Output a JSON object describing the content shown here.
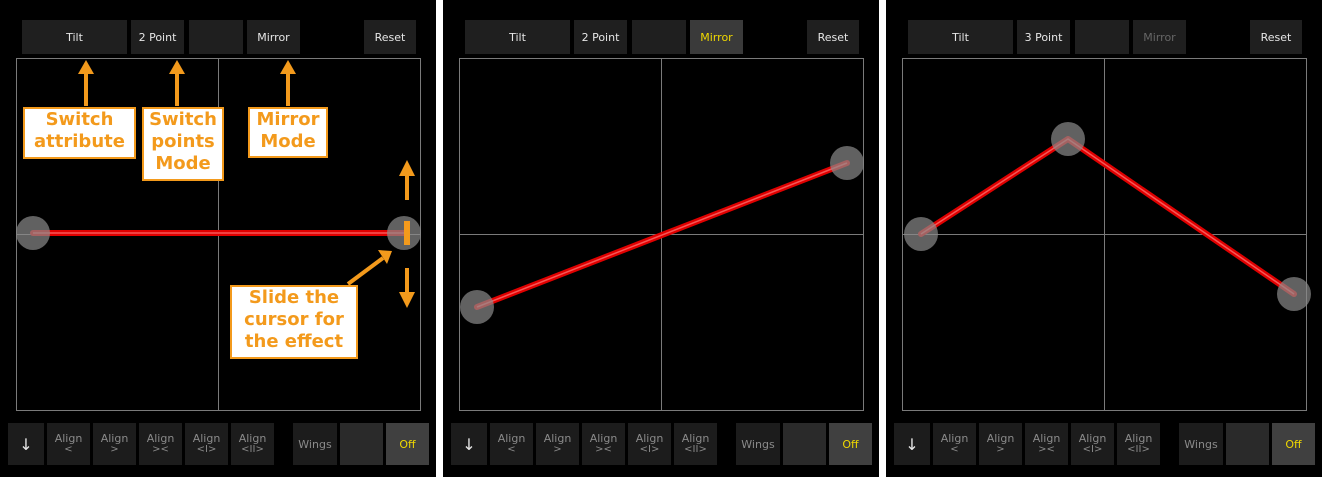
{
  "panels": [
    {
      "toolbar": {
        "attribute": "Tilt",
        "points": "2 Point",
        "blank": "",
        "mirror": "Mirror",
        "reset": "Reset"
      },
      "mirror_active": false,
      "mirror_dim": false,
      "bottom": {
        "down_arrow": "↓",
        "align1": {
          "label": "Align",
          "sub": "<"
        },
        "align2": {
          "label": "Align",
          "sub": ">"
        },
        "align3": {
          "label": "Align",
          "sub": "><"
        },
        "align4": {
          "label": "Align",
          "sub": "<I>"
        },
        "align5": {
          "label": "Align",
          "sub": "<II>"
        },
        "wings": "Wings",
        "blank": "",
        "off": "Off"
      }
    },
    {
      "toolbar": {
        "attribute": "Tilt",
        "points": "2 Point",
        "blank": "",
        "mirror": "Mirror",
        "reset": "Reset"
      },
      "mirror_active": true,
      "mirror_dim": false,
      "bottom": {
        "down_arrow": "↓",
        "align1": {
          "label": "Align",
          "sub": "<"
        },
        "align2": {
          "label": "Align",
          "sub": ">"
        },
        "align3": {
          "label": "Align",
          "sub": "><"
        },
        "align4": {
          "label": "Align",
          "sub": "<I>"
        },
        "align5": {
          "label": "Align",
          "sub": "<II>"
        },
        "wings": "Wings",
        "blank": "",
        "off": "Off"
      }
    },
    {
      "toolbar": {
        "attribute": "Tilt",
        "points": "3 Point",
        "blank": "",
        "mirror": "Mirror",
        "reset": "Reset"
      },
      "mirror_active": false,
      "mirror_dim": true,
      "bottom": {
        "down_arrow": "↓",
        "align1": {
          "label": "Align",
          "sub": "<"
        },
        "align2": {
          "label": "Align",
          "sub": ">"
        },
        "align3": {
          "label": "Align",
          "sub": "><"
        },
        "align4": {
          "label": "Align",
          "sub": "<I>"
        },
        "align5": {
          "label": "Align",
          "sub": "<II>"
        },
        "wings": "Wings",
        "blank": "",
        "off": "Off"
      }
    }
  ],
  "annotations": {
    "switch_attribute": {
      "line1": "Switch",
      "line2": "attribute"
    },
    "switch_points": {
      "line1": "Switch",
      "line2": "points",
      "line3": "Mode"
    },
    "mirror_mode": {
      "line1": "Mirror",
      "line2": "Mode"
    },
    "slide_cursor": {
      "line1": "Slide the",
      "line2": "cursor for",
      "line3": "the effect"
    }
  },
  "colors": {
    "accent": "#f39a1c",
    "curve": "#e00000",
    "active_text": "#f0d800",
    "panel_bg": "#000000"
  }
}
